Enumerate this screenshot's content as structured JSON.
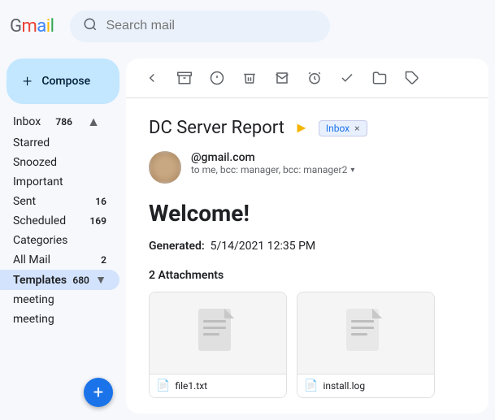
{
  "header": {
    "logo": "Gmail",
    "search_placeholder": "Search mail"
  },
  "sidebar": {
    "compose_label": "Compose",
    "items": [
      {
        "id": "inbox",
        "label": "Inbox",
        "count": "786",
        "active": false
      },
      {
        "id": "starred",
        "label": "Starred",
        "count": "",
        "active": false
      },
      {
        "id": "snoozed",
        "label": "Snoozed",
        "count": "",
        "active": false
      },
      {
        "id": "important",
        "label": "Important",
        "count": "",
        "active": false
      },
      {
        "id": "sent",
        "label": "Sent",
        "count": "16",
        "active": false
      },
      {
        "id": "scheduled",
        "label": "Scheduled",
        "count": "169",
        "active": false
      },
      {
        "id": "categories",
        "label": "Categories",
        "count": "",
        "active": false
      },
      {
        "id": "all",
        "label": "All Mail",
        "count": "2",
        "active": false
      },
      {
        "id": "templates",
        "label": "Templates",
        "count": "680",
        "active": false
      }
    ],
    "section_labels": [
      "meeting",
      "meeting"
    ]
  },
  "toolbar": {
    "back_label": "←",
    "archive_label": "📥",
    "report_label": "⚠",
    "delete_label": "🗑",
    "mark_label": "✉",
    "snooze_label": "🕐",
    "done_label": "✓",
    "move_label": "📁",
    "label_label": "🏷"
  },
  "email": {
    "subject": "DC Server Report",
    "label_arrow": "▶",
    "inbox_badge": "Inbox",
    "sender_email": "@gmail.com",
    "sender_to": "to me, bcc: manager, bcc: manager2",
    "welcome_heading": "Welcome!",
    "generated_label": "Generated:",
    "generated_value": "5/14/2021 12:35 PM",
    "attachments_count": "2 Attachments",
    "attachments": [
      {
        "name": "file1.txt",
        "type": "txt"
      },
      {
        "name": "install.log",
        "type": "log"
      }
    ]
  }
}
